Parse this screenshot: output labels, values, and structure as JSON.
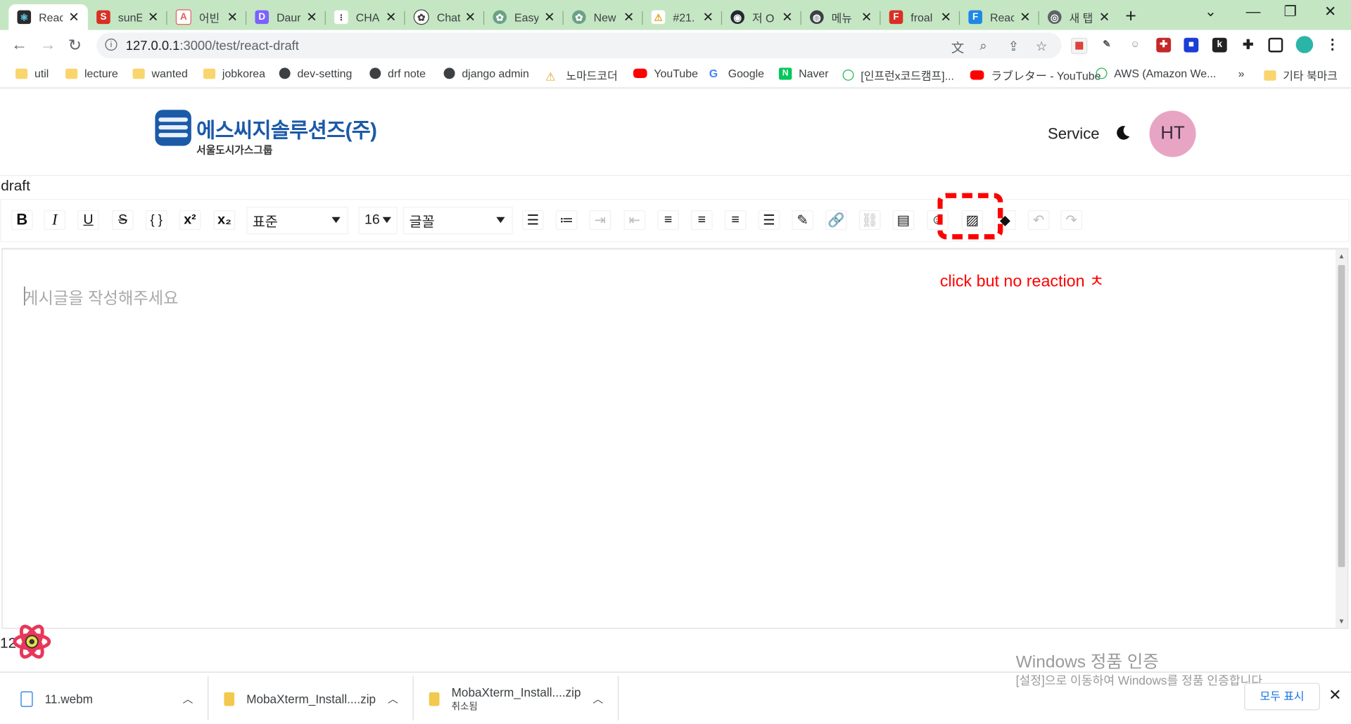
{
  "browser": {
    "tabs": [
      {
        "title": "React",
        "fav": "R",
        "color": "#2b2b2b"
      },
      {
        "title": "sunE",
        "fav": "S",
        "color": "#d93025"
      },
      {
        "title": "어빈",
        "fav": "A",
        "color": "#e0605f"
      },
      {
        "title": "Daun",
        "fav": "D",
        "color": "#7b61ff"
      },
      {
        "title": "CHA",
        "fav": "C",
        "color": "#333333"
      },
      {
        "title": "Chat",
        "fav": "G",
        "color": "#444444"
      },
      {
        "title": "Easy",
        "fav": "E",
        "color": "#6aa187"
      },
      {
        "title": "New",
        "fav": "N",
        "color": "#6aa187"
      },
      {
        "title": "#21.",
        "fav": "!",
        "color": "#e3a21a"
      },
      {
        "title": "저 O",
        "fav": "g",
        "color": "#24292f"
      },
      {
        "title": "메뉴",
        "fav": "m",
        "color": "#3c4043"
      },
      {
        "title": "froal",
        "fav": "F",
        "color": "#d93025"
      },
      {
        "title": "Reac",
        "fav": "F",
        "color": "#1e88e5"
      },
      {
        "title": "새 탭",
        "fav": "C",
        "color": "#5f6368"
      }
    ],
    "new_tab": "+",
    "url_host": "127.0.0.1",
    "url_path": ":3000/test/react-draft",
    "bookmarks": [
      {
        "label": "util",
        "type": "folder"
      },
      {
        "label": "lecture",
        "type": "folder"
      },
      {
        "label": "wanted",
        "type": "folder"
      },
      {
        "label": "jobkorea",
        "type": "folder"
      },
      {
        "label": "dev-setting",
        "type": "globe"
      },
      {
        "label": "drf note",
        "type": "globe"
      },
      {
        "label": "django admin",
        "type": "globe"
      },
      {
        "label": "노마드코더",
        "type": "nomad"
      },
      {
        "label": "YouTube",
        "type": "youtube"
      },
      {
        "label": "Google",
        "type": "google"
      },
      {
        "label": "Naver",
        "type": "naver"
      },
      {
        "label": "[인프런x코드캠프]...",
        "type": "inflearn"
      },
      {
        "label": "ラブレター - YouTube",
        "type": "youtube"
      },
      {
        "label": "AWS (Amazon We...",
        "type": "inflearn"
      }
    ],
    "bookmarks_more": "»",
    "other_bookmarks": "기타 북마크"
  },
  "site": {
    "logo_name": "에스씨지솔루션즈(주)",
    "logo_sub": "서울도시가스그룹",
    "service_link": "Service",
    "avatar_initials": "HT"
  },
  "editor": {
    "title": "draft",
    "block_type": "표준",
    "font_size": "16",
    "font_family": "글꼴",
    "placeholder": "게시글을 작성해주세요",
    "annotation": "click but no reaction ㅊ",
    "counter": "12"
  },
  "downloads": {
    "items": [
      {
        "name": "11.webm",
        "status": ""
      },
      {
        "name": "MobaXterm_Install....zip",
        "status": ""
      },
      {
        "name": "MobaXterm_Install....zip",
        "status": "취소됨"
      }
    ],
    "show_all": "모두 표시"
  },
  "windows": {
    "activate_title": "Windows 정품 인증",
    "activate_sub": "[설정]으로 이동하여 Windows를 정품 인증합니다."
  }
}
